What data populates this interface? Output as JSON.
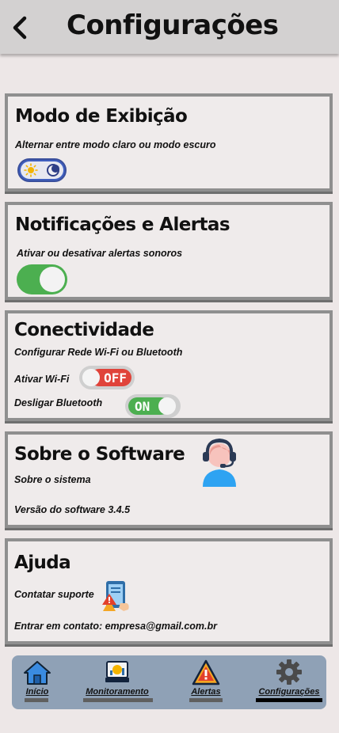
{
  "header": {
    "title": "Configurações"
  },
  "display": {
    "title": "Modo de Exibição",
    "desc": "Alternar entre modo claro ou modo escuro",
    "mode": "light"
  },
  "notifications": {
    "title": "Notificações e Alertas",
    "desc": "Ativar ou desativar alertas sonoros",
    "enabled": true
  },
  "connectivity": {
    "title": "Conectividade",
    "desc": "Configurar Rede Wi-Fi ou Bluetooth",
    "wifi_label": "Ativar Wi-Fi",
    "wifi_state": "OFF",
    "bt_label": "Desligar Bluetooth",
    "bt_state": "ON"
  },
  "about": {
    "title": "Sobre o Software",
    "desc": "Sobre o sistema",
    "version": "Versão do software 3.4.5"
  },
  "help": {
    "title": "Ajuda",
    "desc": "Contatar suporte",
    "contact": "Entrar em contato: empresa@gmail.com.br"
  },
  "nav": {
    "home": "Início",
    "monitoring": "Monitoramento",
    "alerts": "Alertas",
    "settings": "Configurações",
    "active": "settings"
  },
  "colors": {
    "accent_green": "#4caf50",
    "toggle_red": "#e0433a",
    "nav_bg": "#8fa1b6"
  }
}
